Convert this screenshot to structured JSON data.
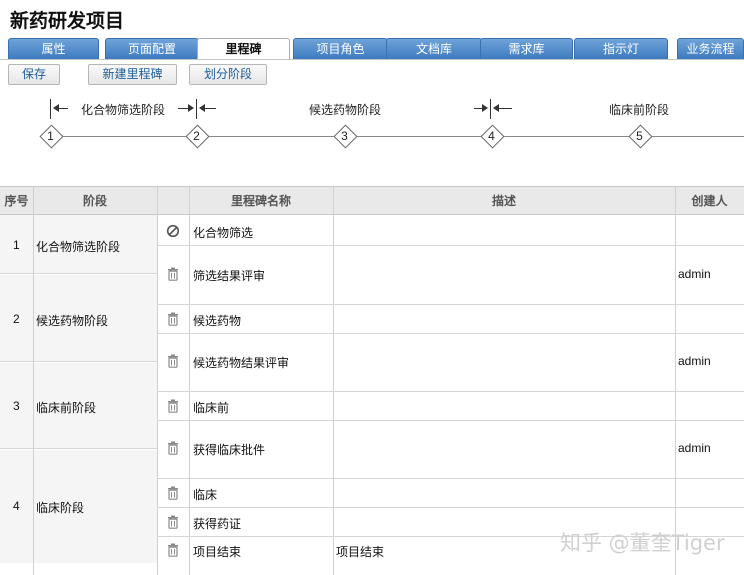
{
  "page_title": "新药研发项目",
  "tabs": [
    {
      "label": "属性",
      "active": false
    },
    {
      "label": "页面配置",
      "active": false
    },
    {
      "label": "里程碑",
      "active": true
    },
    {
      "label": "项目角色",
      "active": false
    },
    {
      "label": "文档库",
      "active": false
    },
    {
      "label": "需求库",
      "active": false
    },
    {
      "label": "指示灯",
      "active": false
    },
    {
      "label": "业务流程",
      "active": false
    }
  ],
  "toolbar": {
    "save": "保存",
    "new_milestone": "新建里程碑",
    "divide_phase": "划分阶段"
  },
  "timeline": {
    "phases": [
      "化合物筛选阶段",
      "候选药物阶段",
      "临床前阶段"
    ],
    "milestones": [
      "1",
      "2",
      "3",
      "4",
      "5"
    ]
  },
  "table": {
    "headers": {
      "index": "序号",
      "phase": "阶段",
      "name": "里程碑名称",
      "desc": "描述",
      "creator": "创建人"
    },
    "groups": [
      {
        "index": "1",
        "phase": "化合物筛选阶段"
      },
      {
        "index": "2",
        "phase": "候选药物阶段"
      },
      {
        "index": "3",
        "phase": "临床前阶段"
      },
      {
        "index": "4",
        "phase": "临床阶段"
      }
    ],
    "rows": [
      {
        "icon": "ban-icon",
        "name": "化合物筛选",
        "desc": "",
        "creator": ""
      },
      {
        "icon": "trash-icon",
        "name": "筛选结果评审",
        "desc": "",
        "creator": "admin"
      },
      {
        "icon": "trash-icon",
        "name": "候选药物",
        "desc": "",
        "creator": ""
      },
      {
        "icon": "trash-icon",
        "name": "候选药物结果评审",
        "desc": "",
        "creator": "admin"
      },
      {
        "icon": "trash-icon",
        "name": "临床前",
        "desc": "",
        "creator": ""
      },
      {
        "icon": "trash-icon",
        "name": "获得临床批件",
        "desc": "",
        "creator": "admin"
      },
      {
        "icon": "trash-icon",
        "name": "临床",
        "desc": "",
        "creator": ""
      },
      {
        "icon": "trash-icon",
        "name": "获得药证",
        "desc": "",
        "creator": ""
      },
      {
        "icon": "trash-icon",
        "name": "项目结束",
        "desc": "项目结束",
        "creator": ""
      }
    ]
  },
  "watermark": "知乎 @董奎Tiger"
}
